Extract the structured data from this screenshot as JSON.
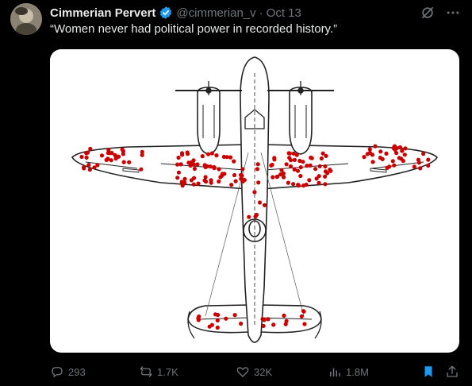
{
  "tweet": {
    "author_name": "Cimmerian Pervert",
    "handle": "@cimmerian_v",
    "separator": "·",
    "date": "Oct 13",
    "verified": true,
    "text": "“Women never had political power in recorded history.”",
    "icons": {
      "verified": "verified-badge-icon",
      "grok": "grok-icon",
      "more": "more-dots-icon"
    }
  },
  "media": {
    "description_icon": "airplane-bullet-hole-diagram",
    "dot_color": "#cc0000"
  },
  "actions": {
    "reply_count": "293",
    "repost_count": "1.7K",
    "like_count": "32K",
    "view_count": "1.8M",
    "icons": {
      "reply": "reply-icon",
      "repost": "repost-icon",
      "like": "like-icon",
      "views": "views-icon",
      "bookmark": "bookmark-icon",
      "share": "share-icon"
    }
  },
  "colors": {
    "background": "#000000",
    "text_primary": "#e7e9ea",
    "text_secondary": "#71767b",
    "verified_blue": "#1d9bf0",
    "bookmark_blue": "#1d9bf0"
  }
}
